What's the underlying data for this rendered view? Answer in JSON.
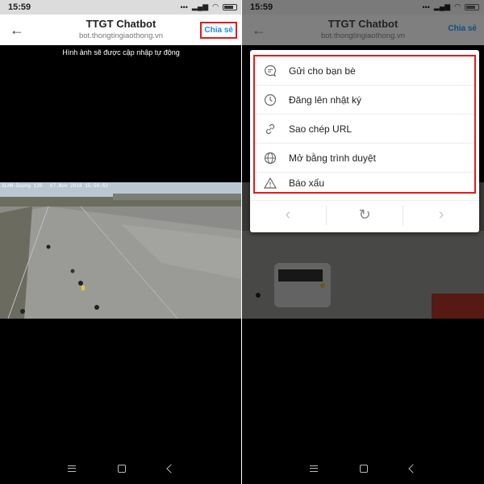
{
  "status": {
    "time": "15:59"
  },
  "appbar": {
    "title": "TTGT Chatbot",
    "subtitle": "bot.thongtingiaothong.vn",
    "share_label": "Chia sẻ"
  },
  "caption": "Hình ảnh sẽ được cập nhập tự động",
  "camera": {
    "location": "XLHN-Duong 120",
    "datetime": "07.Nov 2018 15:58:52"
  },
  "menu": {
    "items": [
      {
        "label": "Gửi cho bạn bè",
        "icon": "chat-bubble-icon"
      },
      {
        "label": "Đăng lên nhật ký",
        "icon": "clock-icon"
      },
      {
        "label": "Sao chép URL",
        "icon": "link-icon"
      },
      {
        "label": "Mở bằng trình duyệt",
        "icon": "globe-icon"
      },
      {
        "label": "Báo xấu",
        "icon": "warning-icon"
      }
    ],
    "controls": {
      "back": "‹",
      "reload": "↻",
      "forward": "›"
    }
  },
  "colors": {
    "accent": "#1e88e5",
    "highlight": "#e21b1b"
  }
}
